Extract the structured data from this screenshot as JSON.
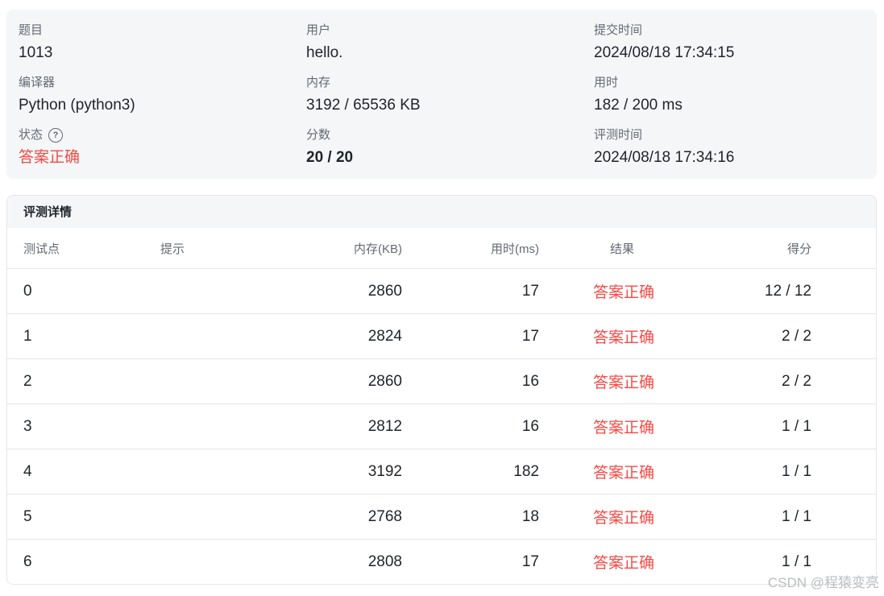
{
  "submission": {
    "problem_label": "题目",
    "problem_value": "1013",
    "user_label": "用户",
    "user_value": "hello.",
    "submit_time_label": "提交时间",
    "submit_time_value": "2024/08/18 17:34:15",
    "compiler_label": "编译器",
    "compiler_value": "Python (python3)",
    "memory_label": "内存",
    "memory_value": "3192 / 65536 KB",
    "time_label": "用时",
    "time_value": "182 / 200 ms",
    "status_label": "状态",
    "status_help_icon": "question-circle-icon",
    "status_help_glyph": "?",
    "status_value": "答案正确",
    "score_label": "分数",
    "score_value": "20 / 20",
    "judge_time_label": "评测时间",
    "judge_time_value": "2024/08/18 17:34:16"
  },
  "details": {
    "title": "评测详情",
    "headers": {
      "case": "测试点",
      "hint": "提示",
      "memory": "内存(KB)",
      "time": "用时(ms)",
      "result": "结果",
      "score": "得分"
    },
    "rows": [
      {
        "case": "0",
        "hint": "",
        "memory": "2860",
        "time": "17",
        "result": "答案正确",
        "score": "12 / 12"
      },
      {
        "case": "1",
        "hint": "",
        "memory": "2824",
        "time": "17",
        "result": "答案正确",
        "score": "2 / 2"
      },
      {
        "case": "2",
        "hint": "",
        "memory": "2860",
        "time": "16",
        "result": "答案正确",
        "score": "2 / 2"
      },
      {
        "case": "3",
        "hint": "",
        "memory": "2812",
        "time": "16",
        "result": "答案正确",
        "score": "1 / 1"
      },
      {
        "case": "4",
        "hint": "",
        "memory": "3192",
        "time": "182",
        "result": "答案正确",
        "score": "1 / 1"
      },
      {
        "case": "5",
        "hint": "",
        "memory": "2768",
        "time": "18",
        "result": "答案正确",
        "score": "1 / 1"
      },
      {
        "case": "6",
        "hint": "",
        "memory": "2808",
        "time": "17",
        "result": "答案正确",
        "score": "1 / 1"
      }
    ]
  },
  "colors": {
    "accepted": "#f54a45",
    "card_background": "#f5f6f7",
    "label": "#646a73"
  },
  "watermark": "CSDN @程猿变亮"
}
